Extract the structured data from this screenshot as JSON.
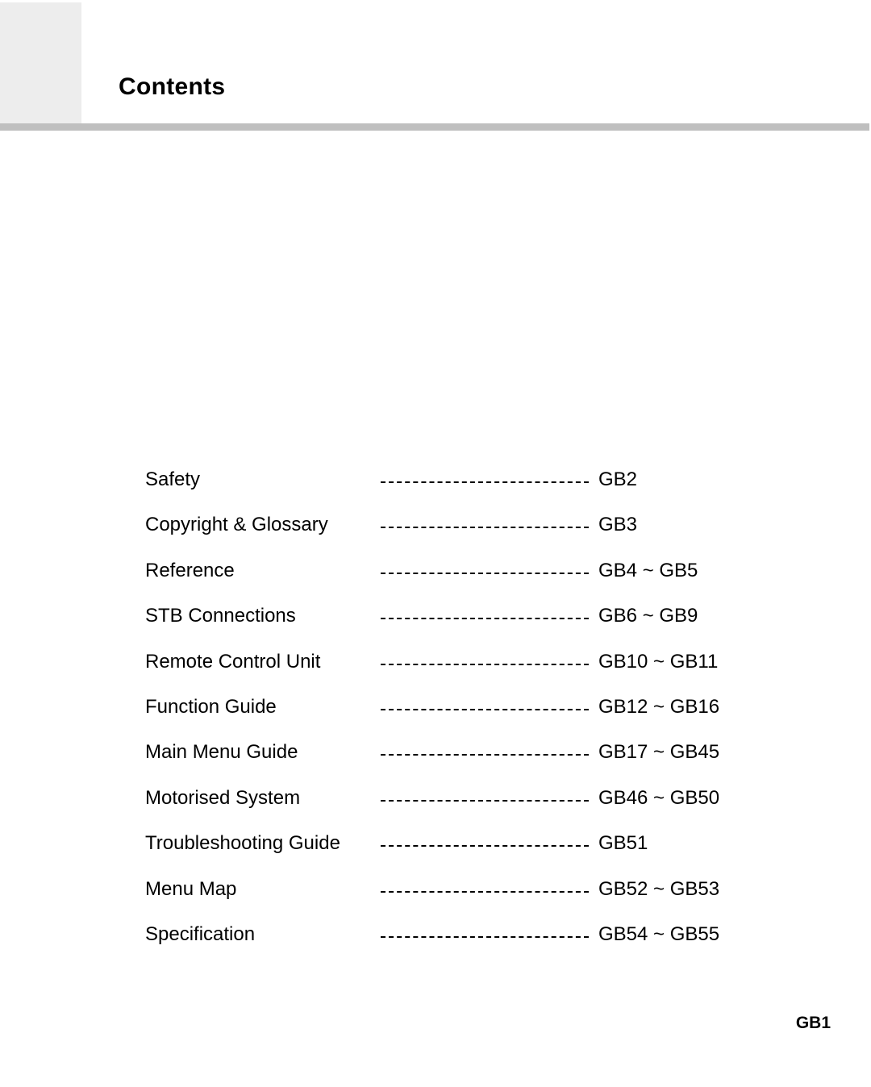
{
  "header": {
    "title": "Contents",
    "tab_color": "#ededed",
    "rule_color": "#bfbfbf"
  },
  "toc": {
    "leader_style": "dashed",
    "entries": [
      {
        "label": "Safety",
        "pages": "GB2"
      },
      {
        "label": "Copyright & Glossary",
        "pages": "GB3"
      },
      {
        "label": "Reference",
        "pages": "GB4 ~ GB5"
      },
      {
        "label": "STB Connections",
        "pages": "GB6 ~ GB9"
      },
      {
        "label": "Remote Control Unit",
        "pages": "GB10 ~ GB11"
      },
      {
        "label": "Function Guide",
        "pages": "GB12 ~ GB16"
      },
      {
        "label": "Main Menu Guide",
        "pages": "GB17 ~ GB45"
      },
      {
        "label": "Motorised System",
        "pages": "GB46 ~ GB50"
      },
      {
        "label": "Troubleshooting Guide",
        "pages": "GB51"
      },
      {
        "label": "Menu Map",
        "pages": "GB52 ~ GB53"
      },
      {
        "label": "Specification",
        "pages": "GB54 ~ GB55"
      }
    ]
  },
  "footer": {
    "page_number": "GB1"
  }
}
